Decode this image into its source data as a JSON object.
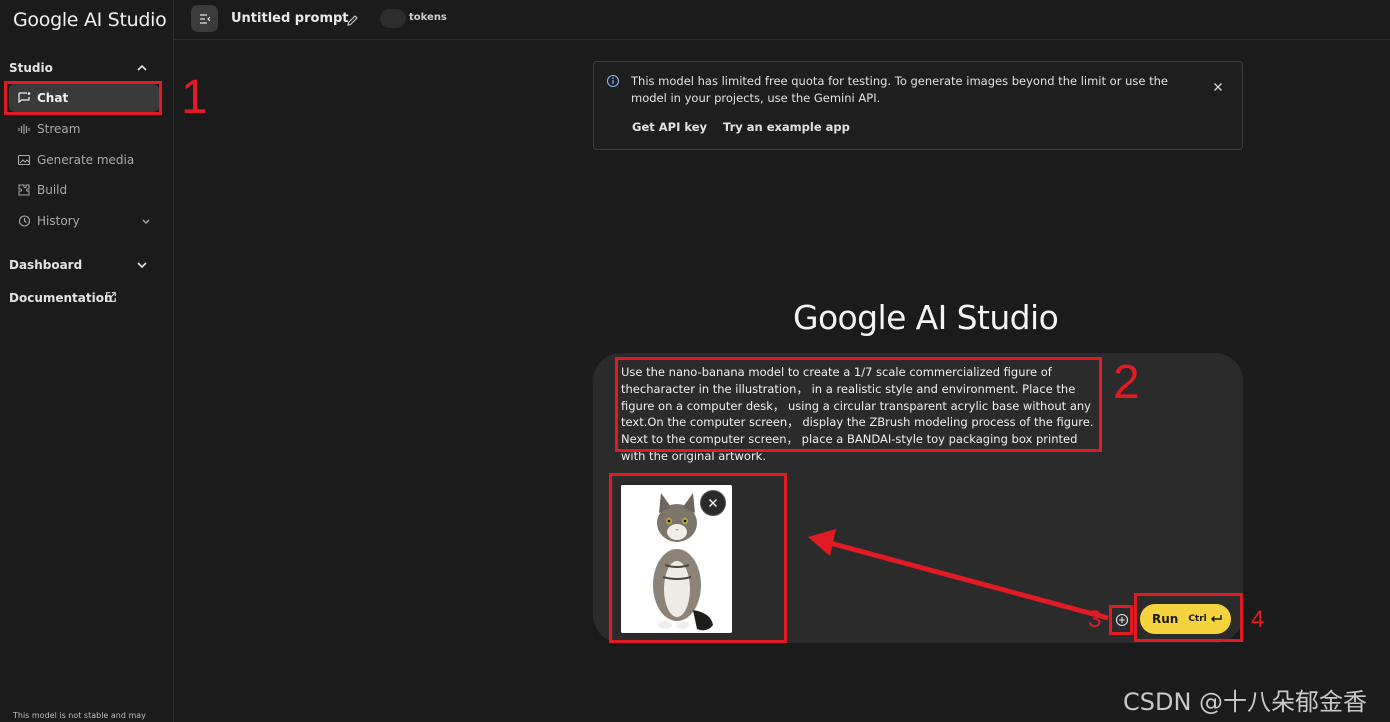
{
  "sidebar": {
    "logo": "Google AI Studio",
    "studio_label": "Studio",
    "items": [
      {
        "label": "Chat",
        "icon": "chat-icon"
      },
      {
        "label": "Stream",
        "icon": "stream-icon"
      },
      {
        "label": "Generate media",
        "icon": "media-icon"
      },
      {
        "label": "Build",
        "icon": "build-icon"
      },
      {
        "label": "History",
        "icon": "history-icon"
      }
    ],
    "dashboard_label": "Dashboard",
    "documentation_label": "Documentation",
    "footer_text": "This model is not stable and may"
  },
  "topbar": {
    "prompt_title": "Untitled prompt",
    "tokens_label": "tokens"
  },
  "banner": {
    "text": "This model has limited free quota for testing. To generate images beyond the limit or use the model in your projects, use the Gemini API.",
    "link_api": "Get API key",
    "link_example": "Try an example app"
  },
  "hero": {
    "title": "Google AI Studio"
  },
  "prompt": {
    "text": "Use the nano-banana model to create a 1/7 scale commercialized figure of thecharacter in the illustration， in a realistic style and environment. Place the figure on a computer desk， using a circular transparent acrylic base without any text.On the computer screen， display the ZBrush modeling process of the figure. Next to the computer screen， place a BANDAI-style toy packaging box printed with the original artwork.",
    "attachment": "cat image",
    "run_label": "Run",
    "run_shortcut": "Ctrl"
  },
  "annotations": {
    "n1": "1",
    "n2": "2",
    "n3": "3",
    "n4": "4",
    "color": "#e01b24"
  },
  "watermark": "CSDN @十八朵郁金香",
  "colors": {
    "background": "#1b1b1b",
    "panel": "#2b2b2b",
    "run_button": "#f5d33e",
    "annotation": "#e01b24"
  }
}
